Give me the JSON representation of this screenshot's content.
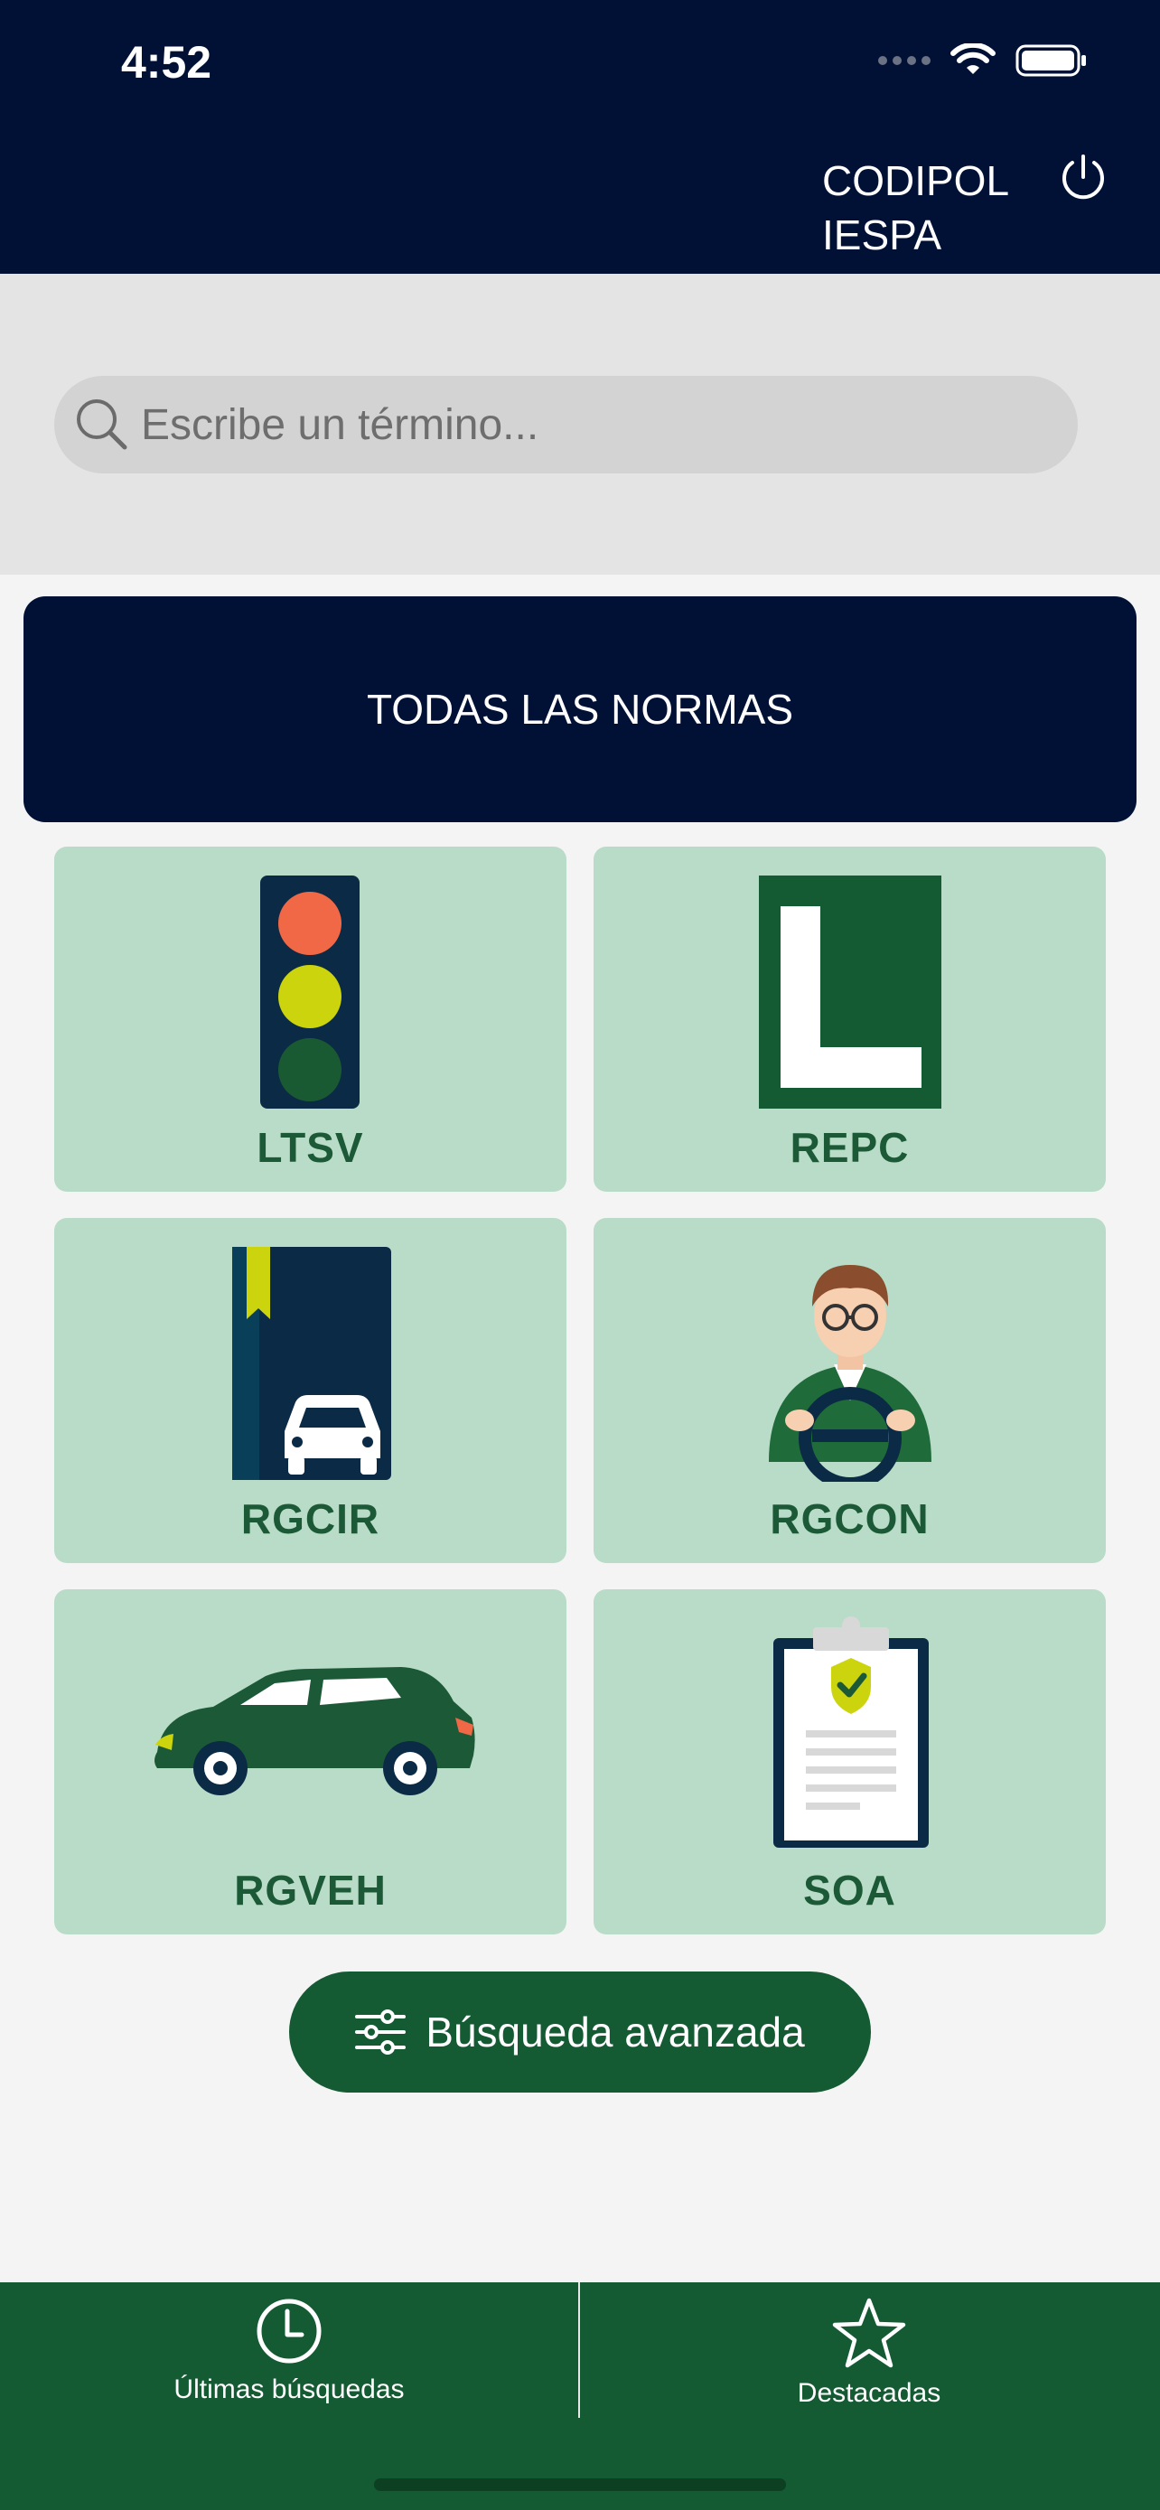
{
  "status_bar": {
    "time": "4:52"
  },
  "header": {
    "title_line1": "CODIPOL",
    "title_line2": "IESPA",
    "power_icon": "power-icon"
  },
  "search": {
    "placeholder": "Escribe un término..."
  },
  "all_norms": {
    "label": "TODAS LAS NORMAS"
  },
  "categories": [
    {
      "label": "LTSV",
      "icon": "traffic-light-icon"
    },
    {
      "label": "REPC",
      "icon": "learner-l-icon"
    },
    {
      "label": "RGCIR",
      "icon": "book-car-icon"
    },
    {
      "label": "RGCON",
      "icon": "driver-icon"
    },
    {
      "label": "RGVEH",
      "icon": "car-icon"
    },
    {
      "label": "SOA",
      "icon": "clipboard-shield-icon"
    }
  ],
  "advanced_search": {
    "label": "Búsqueda avanzada",
    "icon": "sliders-icon"
  },
  "tabbar": {
    "items": [
      {
        "label": "Últimas búsquedas",
        "icon": "clock-icon"
      },
      {
        "label": "Destacadas",
        "icon": "star-icon"
      }
    ]
  },
  "colors": {
    "header_bg": "#011035",
    "tile_bg": "#b9dcc8",
    "tile_label": "#1c5a37",
    "accent_green": "#145a33"
  }
}
